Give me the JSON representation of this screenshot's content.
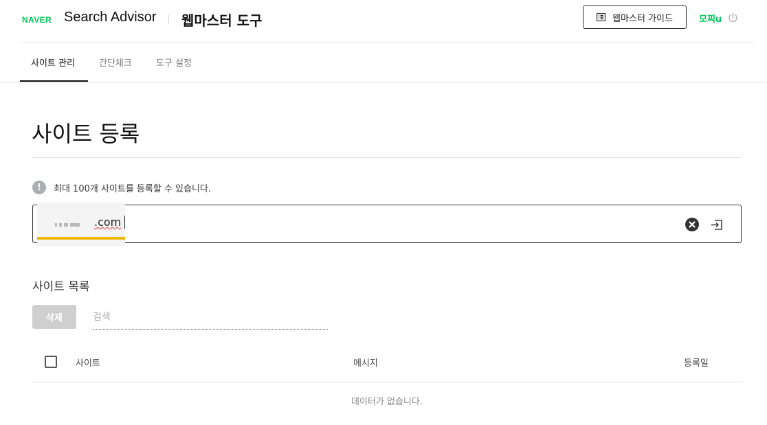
{
  "header": {
    "logo": "NAVER",
    "brand": "Search Advisor",
    "tool_title": "웹마스터 도구",
    "guide_button": "웹마스터 가이드",
    "user_name": "모찌u",
    "icons": {
      "guide": "book-icon",
      "power": "power-icon"
    }
  },
  "tabs": [
    {
      "label": "사이트 관리",
      "active": true
    },
    {
      "label": "간단체크",
      "active": false
    },
    {
      "label": "도구 설정",
      "active": false
    }
  ],
  "main": {
    "page_title": "사이트 등록",
    "notice": "최대 100개 사이트를 등록할 수 있습니다.",
    "url_input": {
      "value": ".com",
      "clear_icon": "close-circle-icon",
      "submit_icon": "enter-icon"
    }
  },
  "site_list": {
    "title": "사이트 목록",
    "delete_button": "삭제",
    "search_placeholder": "검색",
    "columns": [
      "사이트",
      "메시지",
      "등록일"
    ],
    "empty_message": "데이터가 없습니다."
  },
  "colors": {
    "brand_green": "#03c75a",
    "highlight_yellow": "#f0b800",
    "disabled_button": "#cfcfcf"
  }
}
